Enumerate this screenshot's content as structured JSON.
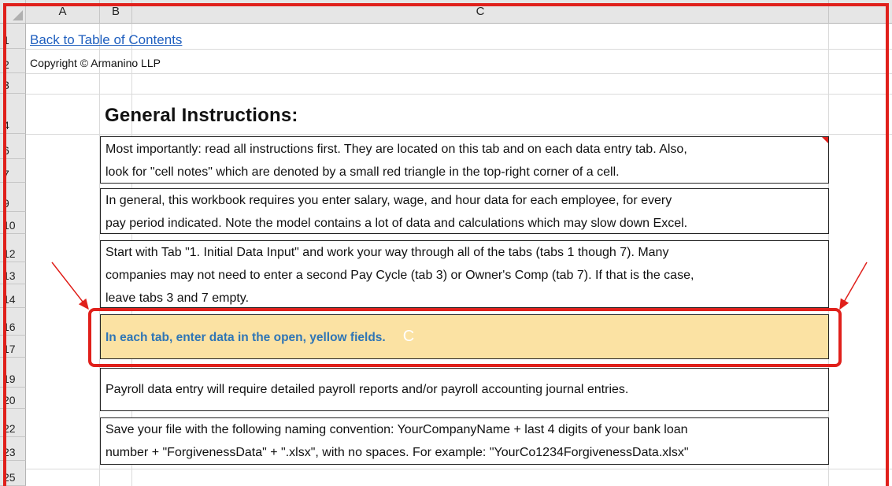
{
  "columns": [
    "A",
    "B",
    "C"
  ],
  "rows": [
    "1",
    "2",
    "3",
    "4",
    "6",
    "7",
    "9",
    "10",
    "12",
    "13",
    "14",
    "16",
    "17",
    "19",
    "20",
    "22",
    "23",
    "25"
  ],
  "link": "Back to Table of Contents",
  "copyright": "Copyright © Armanino LLP",
  "heading": "General Instructions:",
  "boxes": [
    {
      "lines": [
        "Most importantly: read all instructions first. They are located on this tab and on each data entry tab. Also,",
        "look for \"cell notes\" which are denoted by a small red triangle in the top-right corner of a cell."
      ]
    },
    {
      "lines": [
        "In general, this workbook requires you enter salary, wage, and hour data for each employee, for every",
        "pay period indicated. Note the model contains a lot of data and calculations which may slow down Excel."
      ]
    },
    {
      "lines": [
        "Start with Tab \"1. Initial Data Input\" and work your way through all of the tabs (tabs 1 though 7). Many",
        "companies may not need to enter a second Pay Cycle (tab 3) or Owner's Comp (tab 7). If that is the case,",
        "leave tabs 3 and 7 empty."
      ]
    },
    {
      "lines": [
        "In each tab, enter data in the open, yellow fields."
      ],
      "ghost": "C"
    },
    {
      "lines": [
        "Payroll data entry will require detailed payroll reports and/or payroll accounting journal entries."
      ]
    },
    {
      "lines": [
        "Save your file with the following naming convention: YourCompanyName + last 4 digits of your bank loan",
        "number + \"ForgivenessData\" + \".xlsx\", with no spaces. For example: \"YourCo1234ForgivenessData.xlsx\""
      ]
    }
  ],
  "colors": {
    "highlight": "#e0201b",
    "yellow_fill": "#fbe2a3",
    "yellow_text": "#2e75b6",
    "link": "#1f5fbf"
  }
}
